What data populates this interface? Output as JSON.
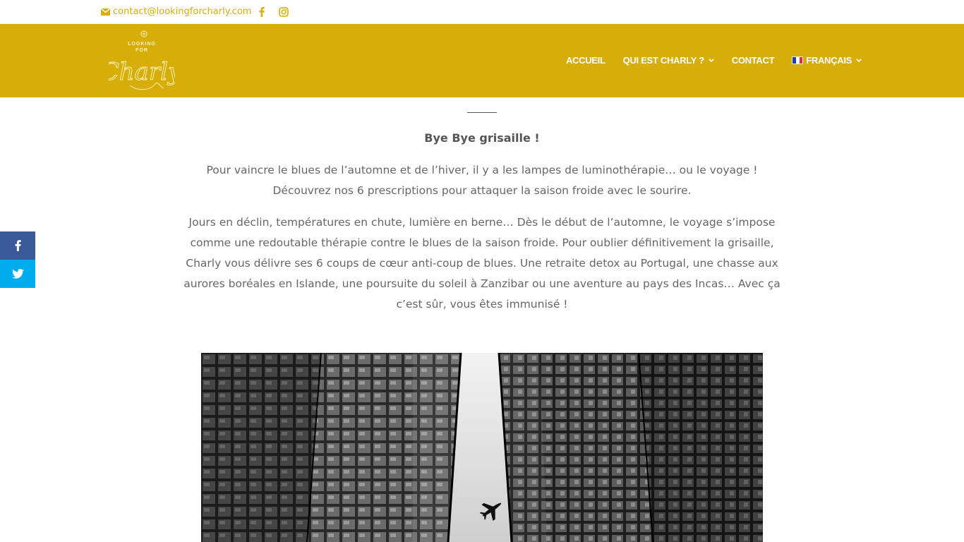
{
  "topbar": {
    "email": "contact@lookingforcharly.com",
    "email_icon": "envelope-icon",
    "social_icons": [
      "facebook-icon",
      "instagram-icon"
    ]
  },
  "colors": {
    "brand": "#d6ae07",
    "text": "#666666",
    "facebook": "#3b5998",
    "twitter": "#00aced"
  },
  "logo": {
    "lines": [
      "LOOKING",
      "FOR",
      "Charly"
    ]
  },
  "nav": {
    "items": [
      {
        "label": "ACCUEIL",
        "dropdown": false
      },
      {
        "label": "QUI EST CHARLY ?",
        "dropdown": true
      },
      {
        "label": "CONTACT",
        "dropdown": false
      },
      {
        "label": "FRANÇAIS",
        "dropdown": true,
        "icon": "flag-fr-icon"
      }
    ]
  },
  "share": {
    "buttons": [
      "facebook-icon",
      "twitter-icon"
    ]
  },
  "article": {
    "title": "Bye Bye grisaille !",
    "intro": "Pour vaincre le blues de l’automne et de l’hiver, il y a les lampes de luminothérapie… ou le voyage ! Découvrez nos 6 prescriptions pour attaquer la saison froide avec le sourire.",
    "body": "Jours en déclin, températures en chute, lumière en berne… Dès le début de l’automne, le voyage s’impose comme une redoutable thérapie contre le blues de la saison froide. Pour oublier définitivement la grisaille, Charly vous délivre ses 6 coups de cœur anti-coup de blues. Une retraite detox au Portugal, une chasse aux aurores boréales en Islande, une poursuite du soleil à Zanzibar ou une aventure au pays des Incas… Avec ça c’est sûr, vous êtes immunisé !"
  },
  "hero": {
    "subject": "airplane-between-skyscrapers-photo"
  }
}
